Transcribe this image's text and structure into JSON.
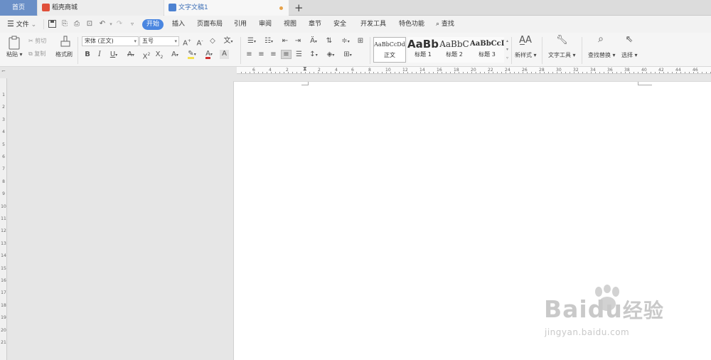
{
  "tabs": {
    "home": "首页",
    "store": "稻壳商城",
    "doc": "文字文稿1",
    "new_tab": "+"
  },
  "menu": {
    "file": "文件",
    "start": "开始",
    "items": [
      "插入",
      "页面布局",
      "引用",
      "审阅",
      "视图",
      "章节",
      "安全",
      "开发工具",
      "特色功能"
    ],
    "search": "查找"
  },
  "ribbon": {
    "paste": "粘贴",
    "cut": "剪切",
    "copy": "复制",
    "format_painter": "格式刷",
    "font_name": "宋体 (正文)",
    "font_size": "五号",
    "styles": [
      {
        "preview": "AaBbCcDd",
        "name": "正文"
      },
      {
        "preview": "AaBb",
        "name": "标题 1"
      },
      {
        "preview": "AaBbC",
        "name": "标题 2"
      },
      {
        "preview": "AaBbCcI",
        "name": "标题 3"
      }
    ],
    "new_style": "新样式",
    "text_tools": "文字工具",
    "find_replace": "查找替换",
    "select": "选择"
  },
  "ruler": {
    "h_ticks": [
      "6",
      "4",
      "2",
      "2",
      "4",
      "6",
      "8",
      "10",
      "12",
      "14",
      "16",
      "18",
      "20",
      "22",
      "24",
      "26",
      "28",
      "30",
      "32",
      "34",
      "36",
      "38",
      "40",
      "42",
      "44",
      "46"
    ],
    "v_ticks": [
      "1",
      "2",
      "3",
      "4",
      "5",
      "6",
      "7",
      "8",
      "9",
      "10",
      "11",
      "12",
      "13",
      "14",
      "15",
      "16",
      "17",
      "18",
      "19",
      "20",
      "21"
    ]
  },
  "watermark": {
    "brand_a": "Bai",
    "brand_b": "du",
    "brand_cn": "经验",
    "url": "jingyan.baidu.com"
  },
  "colors": {
    "accent": "#4a86e0",
    "home_tab": "#6a8fc7",
    "highlight": "#f4e04d",
    "font_color": "#d03030"
  },
  "icons": {
    "menu": "hamburger-icon",
    "save": "save-icon",
    "print": "print-icon",
    "undo": "undo-icon",
    "redo": "redo-icon",
    "search": "magnifier-icon"
  }
}
